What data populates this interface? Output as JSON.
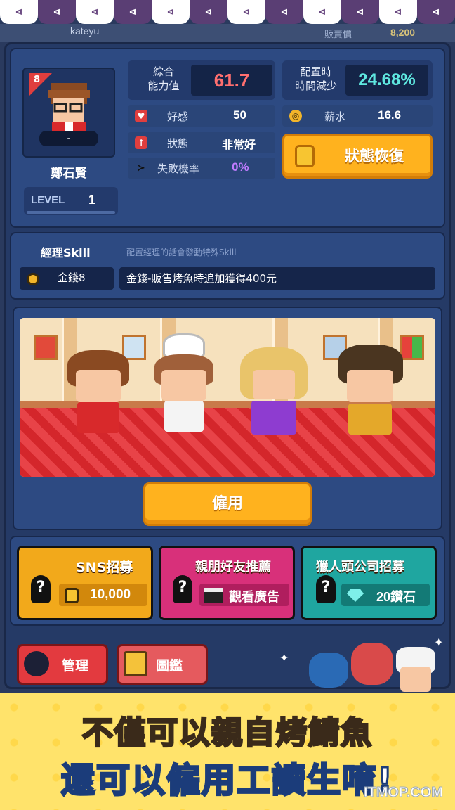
{
  "awning": {
    "labels": [
      "ᐊ",
      "ᐊ",
      "ᐊ",
      "ᐊ",
      "ᐊ",
      "ᐊ",
      "ᐊ",
      "ᐊ",
      "ᐊ",
      "ᐊ",
      "ᐊ",
      "ᐊ"
    ]
  },
  "topbar": {
    "username": "kateyu",
    "price_label": "販賣價",
    "price_value": "8,200"
  },
  "character": {
    "rank_badge": "8",
    "tag": "-",
    "name": "鄭石賢",
    "level_label": "LEVEL",
    "level_value": "1",
    "overall_label_1": "綜合",
    "overall_label_2": "能力值",
    "overall_value": "61.7",
    "reduce_label_1": "配置時",
    "reduce_label_2": "時間減少",
    "reduce_value": "24.68%",
    "like_label": "好感",
    "like_value": "50",
    "salary_label": "薪水",
    "salary_value": "16.6",
    "status_label": "狀態",
    "status_value": "非常好",
    "fail_label": "失敗機率",
    "fail_value": "0%",
    "recover_button": "狀態恢復"
  },
  "skill": {
    "title": "經理Skill",
    "description": "配置經理的話會發動特殊Skill",
    "name": "金錢8",
    "effect": "金錢-販售烤魚時追加獲得400元"
  },
  "hire_button": "僱用",
  "recruit": {
    "sns_title": "SNS招募",
    "sns_cost": "10,000",
    "friend_title": "親朋好友推薦",
    "friend_action": "觀看廣告",
    "headhunter_title": "獵人頭公司招募",
    "headhunter_cost": "20鑽石"
  },
  "tabs": {
    "manage": "管理",
    "catalog": "圖鑑"
  },
  "banner": {
    "line1": "不僅可以親自烤鯖魚",
    "line2": "還可以僱用工讀生唷!",
    "watermark": "ITMOP.COM"
  },
  "colors": {
    "accent_orange": "#ffb21e",
    "overall_red": "#ff6f6f",
    "reduce_cyan": "#5fe8e0",
    "fail_purple": "#c07cff",
    "sns_gold": "#f2a91b",
    "friend_pink": "#d8307a",
    "headhunter_teal": "#1fa6a0"
  },
  "icons": [
    "heart-icon",
    "coin-icon",
    "arrow-up-icon",
    "fish-icon",
    "clapper-icon",
    "diamond-icon",
    "search-icon",
    "book-icon",
    "question-icon",
    "sparkle-icon"
  ]
}
